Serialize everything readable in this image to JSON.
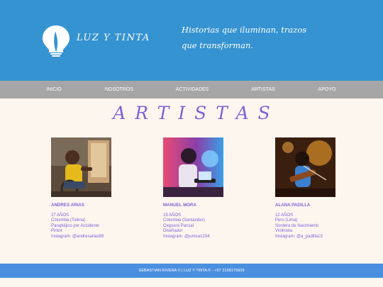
{
  "brand": {
    "name": "LUZ Y TINTA",
    "tagline": "Historias que iluminan, trazos que transforman."
  },
  "nav": {
    "items": [
      "INICIO",
      "NOSOTROS",
      "ACTIVIDADES",
      "ARTISTAS",
      "APOYO"
    ]
  },
  "page": {
    "title": "ARTISTAS"
  },
  "artists": [
    {
      "name": "ANDRES ARIAS",
      "age": "27 AÑOS",
      "location": "Colombia (Tolima)",
      "condition": "Parapléjico por Accidente",
      "profession": "Pintor",
      "instagram": "Instagram: @andresariax89"
    },
    {
      "name": "MANUEL MORA",
      "age": "19 AÑOS",
      "location": "Colombia (Santander)",
      "condition": "Ceguera Parcial",
      "profession": "Diseñador",
      "instagram": "Instagram: @jumca1234"
    },
    {
      "name": "ALANA PADILLA",
      "age": "12 AÑOS",
      "location": "Peru (Lima)",
      "condition": "Sordera de Nacimiento",
      "profession": "Violinista",
      "instagram": "Instagram: @a_padilla13"
    }
  ],
  "footer": {
    "text": "SEBASTIAN RIVERA © | LUZ Y TINTA © - +57 3158175609"
  },
  "colors": {
    "header": "#3593d1",
    "nav": "#a6a6a6",
    "accent": "#7a63d6",
    "footer": "#4a8fe0",
    "background": "#fdf6ef"
  },
  "icons": {
    "logo": "lightbulb-quill-icon"
  }
}
